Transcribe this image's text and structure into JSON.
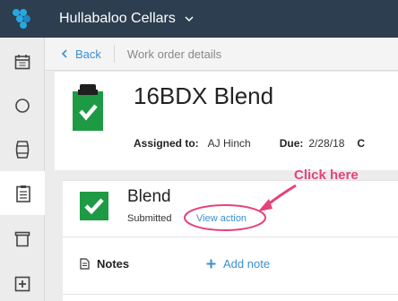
{
  "topbar": {
    "company_name": "Hullabaloo Cellars"
  },
  "breadcrumb": {
    "back_label": "Back",
    "current": "Work order details"
  },
  "work_order": {
    "title": "16BDX Blend",
    "assigned_label": "Assigned to:",
    "assigned_value": "AJ Hinch",
    "due_label": "Due:",
    "due_value": "2/28/18",
    "extra_label": "C"
  },
  "task": {
    "title": "Blend",
    "status": "Submitted",
    "view_action_label": "View action",
    "notes_label": "Notes",
    "add_note_label": "Add note"
  },
  "annotation": {
    "label": "Click here"
  },
  "colors": {
    "topbar": "#2c3e50",
    "accent_blue": "#3b8fd0",
    "success_green": "#1e9a45",
    "annotation_pink": "#e8417a"
  }
}
